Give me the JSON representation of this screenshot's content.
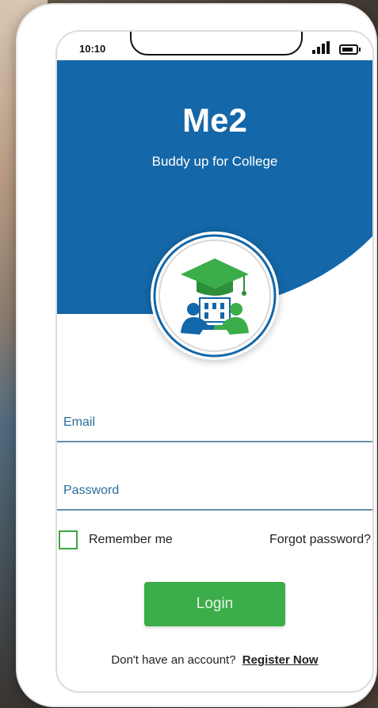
{
  "status_bar": {
    "time": "10:10"
  },
  "header": {
    "brand": "Me2",
    "tagline": "Buddy up for College"
  },
  "form": {
    "email_placeholder": "Email",
    "password_placeholder": "Password",
    "remember_label": "Remember me",
    "forgot_label": "Forgot password?",
    "login_label": "Login"
  },
  "footer": {
    "prompt": "Don't have an account?",
    "register_label": "Register Now"
  },
  "colors": {
    "brand_blue": "#1467a8",
    "accent_green": "#3bad49"
  },
  "icons": [
    "signal-icon",
    "battery-icon",
    "graduation-buddies-logo-icon",
    "checkbox-icon"
  ]
}
